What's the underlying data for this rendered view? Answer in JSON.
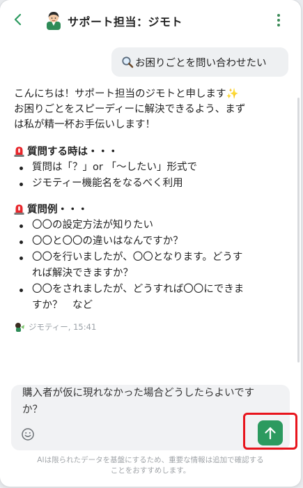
{
  "header": {
    "title": "サポート担当：ジモト",
    "back_icon": "chevron-left-icon",
    "menu_icon": "more-vertical-icon",
    "accent_color": "#2c9a5f"
  },
  "user_message": {
    "icon": "magnifier-icon",
    "text": "お困りごとを問い合わせたい"
  },
  "bot_message": {
    "intro_line1": "こんにちは！サポート担当のジモトと申します✨",
    "intro_line2": "お困りごとをスピーディーに解決できるよう、まず",
    "intro_line3": "は私が精一杯お手伝いします！",
    "section1_title": "質問する時は・・・",
    "section1_items": [
      "質問は「？」or 「〜したい」形式で",
      "ジモティー機能名をなるべく利用"
    ],
    "section2_title": "質問例・・・",
    "section2_items": [
      "〇〇の設定方法が知りたい",
      "〇〇と〇〇の違いはなんですか？",
      "〇〇を行いましたが、〇〇となります。どうす",
      "れば解決できますか？",
      "〇〇をされましたが、どうすれば〇〇にできま",
      "すか？　など"
    ],
    "sender": "ジモティー, 15:41"
  },
  "composer": {
    "line1": "購入者が仮に現れなかった場合どうしたらよいです",
    "line2": "か？",
    "emoji_icon": "smiley-icon",
    "send_icon": "arrow-up-icon",
    "send_color": "#2c9a5f",
    "highlight_color": "#e8141c"
  },
  "disclaimer": {
    "line1": "AIは限られたデータを基盤にするため、重要な情報は追加で確認する",
    "line2": "ことをおすすめします。"
  }
}
